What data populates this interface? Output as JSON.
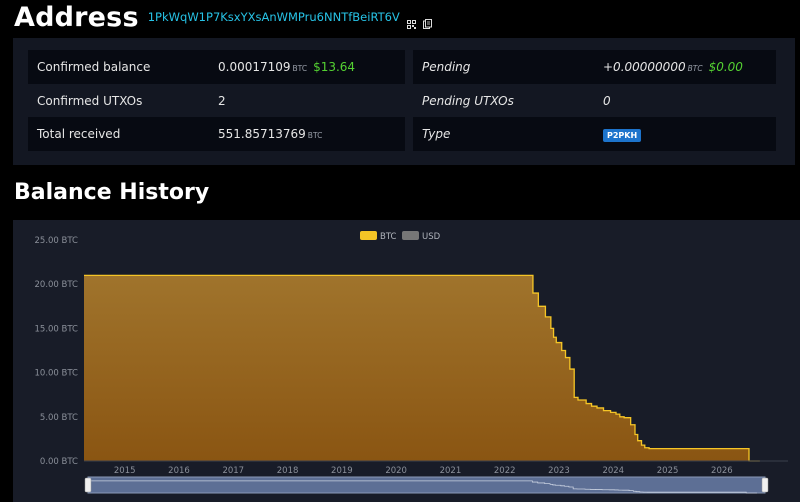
{
  "header": {
    "title": "Address",
    "hash": "1PkWqW1P7KsxYXsAnWMPru6NNTfBeiRT6V",
    "qr_icon": "qr-code-icon",
    "copy_icon": "copy-icon"
  },
  "info": {
    "left": [
      {
        "label": "Confirmed balance",
        "value": "0.00017109",
        "unit": "BTC",
        "fiat": "$13.64"
      },
      {
        "label": "Confirmed UTXOs",
        "value": "2"
      },
      {
        "label": "Total received",
        "value": "551.85713769",
        "unit": "BTC"
      }
    ],
    "right": [
      {
        "label": "Pending",
        "value": "+0.00000000",
        "unit": "BTC",
        "fiat": "$0.00"
      },
      {
        "label": "Pending UTXOs",
        "value": "0"
      },
      {
        "label": "Type",
        "badge": "P2PKH"
      }
    ]
  },
  "section_title": "Balance History",
  "colors": {
    "accent": "#27c3e6",
    "fiat": "#54d132",
    "btc_line": "#f5c526",
    "btc_fill_top": "#a0742c",
    "btc_fill_bottom": "#8a5512",
    "badge": "#1d74cc"
  },
  "chart_data": {
    "type": "area",
    "title": "",
    "legend": [
      {
        "name": "BTC",
        "color": "#f5c526",
        "active": true
      },
      {
        "name": "USD",
        "color": "#888888",
        "active": false
      }
    ],
    "legend_position": "top-center",
    "y_ticks": [
      "0.00 BTC",
      "5.00 BTC",
      "10.00 BTC",
      "15.00 BTC",
      "20.00 BTC",
      "25.00 BTC"
    ],
    "y_tick_values": [
      0,
      5,
      10,
      15,
      20,
      25
    ],
    "ylim": [
      0,
      25
    ],
    "x_ticks": [
      "2015",
      "2016",
      "2017",
      "2018",
      "2019",
      "2020",
      "2021",
      "2022",
      "2023",
      "2024",
      "2025",
      "2026"
    ],
    "x_tick_values": [
      2015,
      2016,
      2017,
      2018,
      2019,
      2020,
      2021,
      2022,
      2023,
      2024,
      2025,
      2026
    ],
    "xlim": [
      2014.25,
      2026.85
    ],
    "series": [
      {
        "name": "BTC",
        "x": [
          2014.2,
          2022.38,
          2022.52,
          2022.62,
          2022.75,
          2022.85,
          2022.9,
          2022.95,
          2023.05,
          2023.12,
          2023.2,
          2023.28,
          2023.35,
          2023.5,
          2023.6,
          2023.7,
          2023.82,
          2023.95,
          2024.05,
          2024.12,
          2024.2,
          2024.32,
          2024.4,
          2024.45,
          2024.52,
          2024.58,
          2024.66,
          2025.0,
          2025.5,
          2026.0,
          2026.2,
          2026.45,
          2026.5,
          2026.7
        ],
        "y": [
          21.0,
          21.0,
          19.0,
          17.5,
          16.3,
          15.0,
          14.0,
          13.4,
          12.5,
          11.7,
          10.4,
          7.2,
          6.9,
          6.5,
          6.2,
          6.0,
          5.7,
          5.5,
          5.3,
          5.0,
          4.9,
          4.1,
          3.0,
          2.3,
          1.8,
          1.5,
          1.4,
          1.4,
          1.4,
          1.4,
          1.4,
          1.4,
          0.0,
          0.0
        ]
      }
    ],
    "grid": false,
    "navigator": {
      "enabled": true,
      "range": [
        0.0,
        1.0
      ]
    }
  }
}
